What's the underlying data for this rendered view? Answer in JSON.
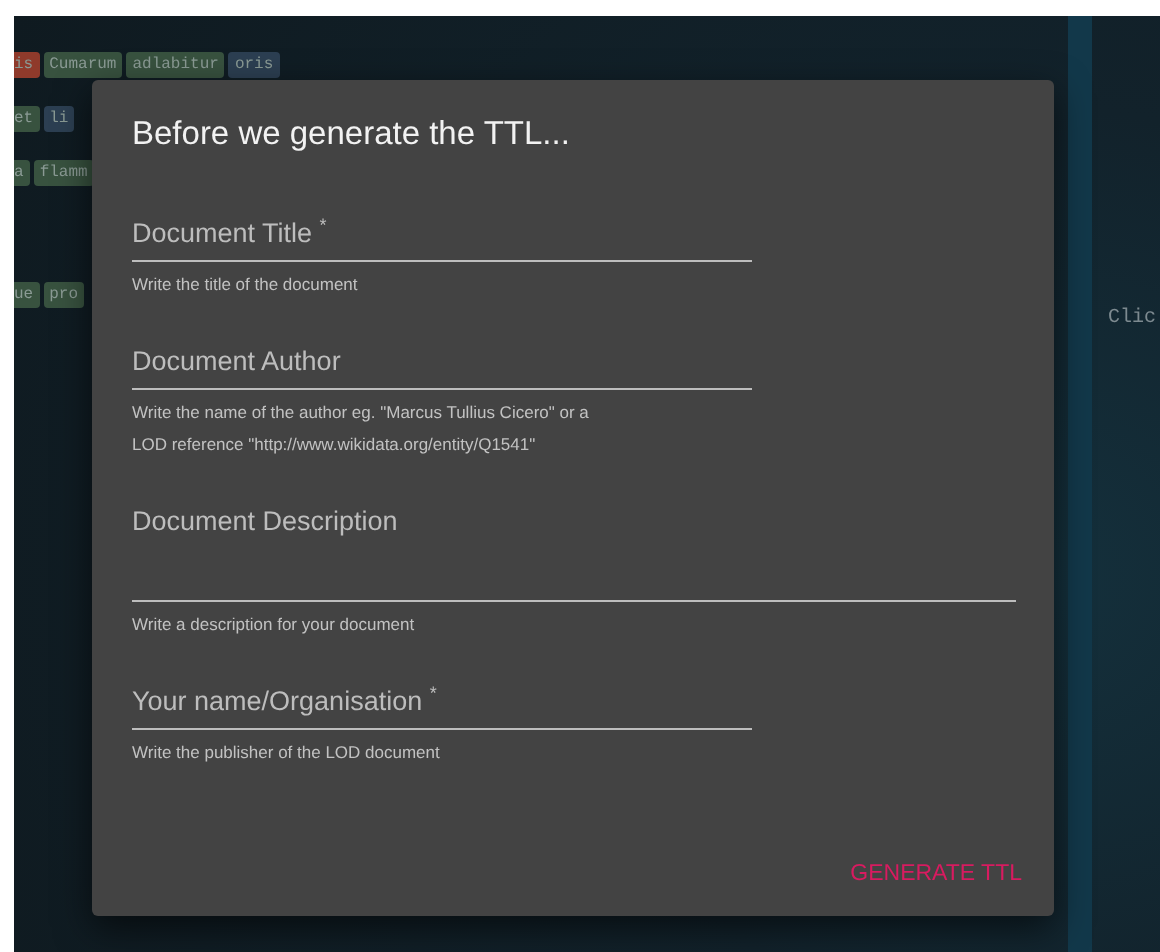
{
  "background_tags": [
    [
      {
        "text": "is",
        "color": "#8f3a2b"
      },
      {
        "text": "Cumarum",
        "color": "#38523f"
      },
      {
        "text": "adlabitur",
        "color": "#38523f"
      },
      {
        "text": "oris",
        "color": "#2c3f52"
      }
    ],
    [
      {
        "text": "et",
        "color": "#38523f"
      },
      {
        "text": "li",
        "color": "#2c3f52"
      }
    ],
    [
      {
        "text": "a",
        "color": "#38523f"
      },
      {
        "text": "flamm",
        "color": "#38523f"
      }
    ],
    [
      {
        "text": "ue",
        "color": "#38523f"
      },
      {
        "text": "pro",
        "color": "#38523f"
      }
    ]
  ],
  "side_text": "Clic",
  "dialog": {
    "title": "Before we generate the TTL...",
    "fields": [
      {
        "kind": "text",
        "label": "Document Title $^{*}$",
        "helper": [
          "Write the title of the document"
        ]
      },
      {
        "kind": "text",
        "label": "Document Author",
        "helper": [
          "Write the name of the author eg. \"Marcus Tullius Cicero\" or a",
          "LOD reference \"http://www.wikidata.org/entity/Q1541\""
        ]
      },
      {
        "kind": "textarea",
        "label": "Document Description",
        "helper": [
          "Write a description for your document"
        ]
      },
      {
        "kind": "text",
        "label": "Your name/Organisation $^{*}$",
        "helper": [
          "Write the publisher of the LOD document"
        ]
      }
    ],
    "button": "GENERATE TTL"
  }
}
